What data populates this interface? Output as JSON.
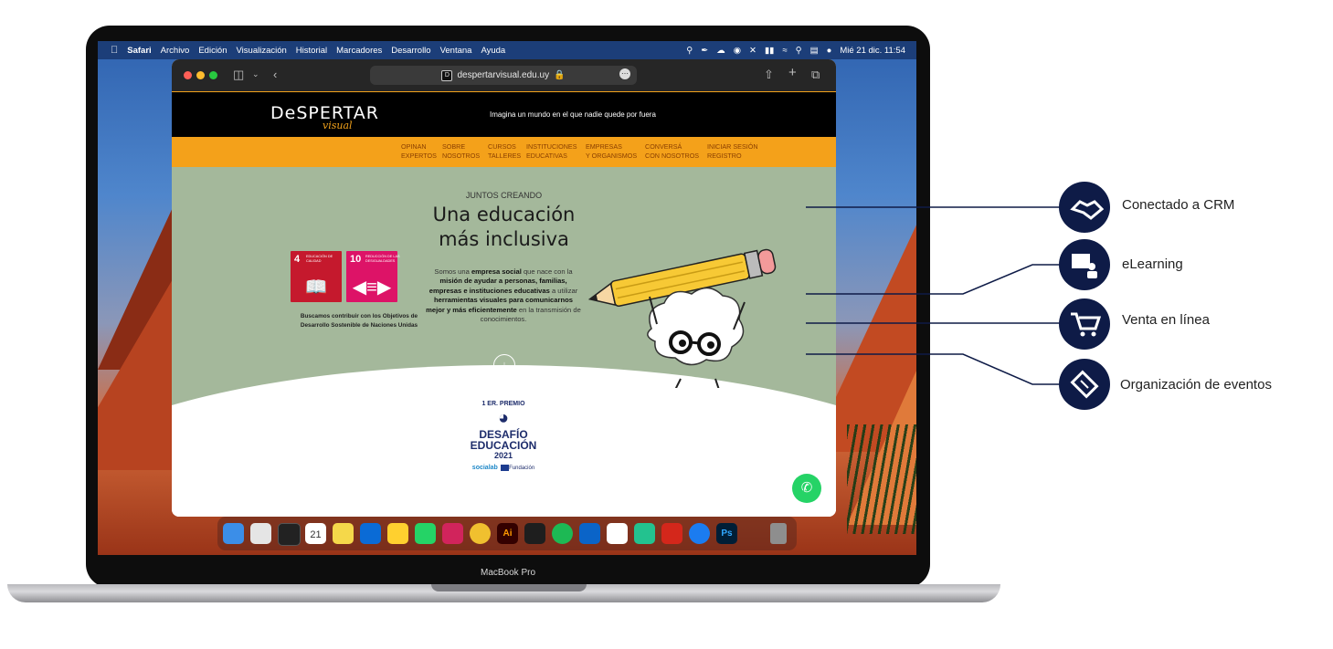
{
  "menubar": {
    "apple": "",
    "app_name": "Safari",
    "items": [
      "Archivo",
      "Edición",
      "Visualización",
      "Historial",
      "Marcadores",
      "Desarrollo",
      "Ventana",
      "Ayuda"
    ],
    "datetime": "Mié 21 dic.  11:54"
  },
  "browser": {
    "url": "despertarvisual.edu.uy",
    "lock_icon": "lock-icon"
  },
  "site": {
    "logo": "DeSPERTAR",
    "logo_sub": "visual",
    "tagline": "Imagina un mundo en el que nadie quede por fuera",
    "nav": [
      {
        "line1": "OPINAN",
        "line2": "EXPERTOS"
      },
      {
        "line1": "SOBRE",
        "line2": "NOSOTROS"
      },
      {
        "line1": "CURSOS",
        "line2": "TALLERES"
      },
      {
        "line1": "INSTITUCIONES",
        "line2": "EDUCATIVAS"
      },
      {
        "line1": "EMPRESAS",
        "line2": "Y ORGANISMOS"
      },
      {
        "line1": "CONVERSÁ",
        "line2": "CON NOSOTROS"
      },
      {
        "line1": "INICIAR SESIÓN",
        "line2": "REGISTRO"
      }
    ],
    "kicker": "JUNTOS CREANDO",
    "headline_1": "Una educación",
    "headline_2": "más inclusiva",
    "body_1": "Somos una ",
    "body_2": "empresa social",
    "body_3": " que nace con la ",
    "body_4": "misión de ayudar a personas, familias, empresas e instituciones educativas",
    "body_5": " a utilizar ",
    "body_6": "herramientas visuales para comunicarnos mejor y más eficientemente",
    "body_7": " en la transmisión de conocimientos.",
    "sdg_4_num": "4",
    "sdg_4_label": "EDUCACIÓN DE CALIDAD",
    "sdg_10_num": "10",
    "sdg_10_label": "REDUCCIÓN DE LAS DESIGUALDADES",
    "sdg_caption": "Buscamos contribuir con los Objetivos de Desarrollo Sostenible de Naciones Unidas",
    "award_1": "1 ER. PREMIO",
    "award_2": "DESAFÍO",
    "award_3": "EDUCACIÓN",
    "award_4": "2021",
    "sponsor_1": "socialab",
    "sponsor_2": "Fundación"
  },
  "device_label": "MacBook Pro",
  "callouts": [
    {
      "label": "Conectado a CRM",
      "icon": "handshake-icon"
    },
    {
      "label": "eLearning",
      "icon": "teacher-board-icon"
    },
    {
      "label": "Venta en línea",
      "icon": "shopping-cart-icon"
    },
    {
      "label": "Organización de eventos",
      "icon": "ticket-icon"
    }
  ],
  "colors": {
    "orange": "#f4a11a",
    "sage": "#a4b89b",
    "navy": "#0e1b47",
    "sdg4": "#c5192d",
    "sdg10": "#dd1367"
  }
}
